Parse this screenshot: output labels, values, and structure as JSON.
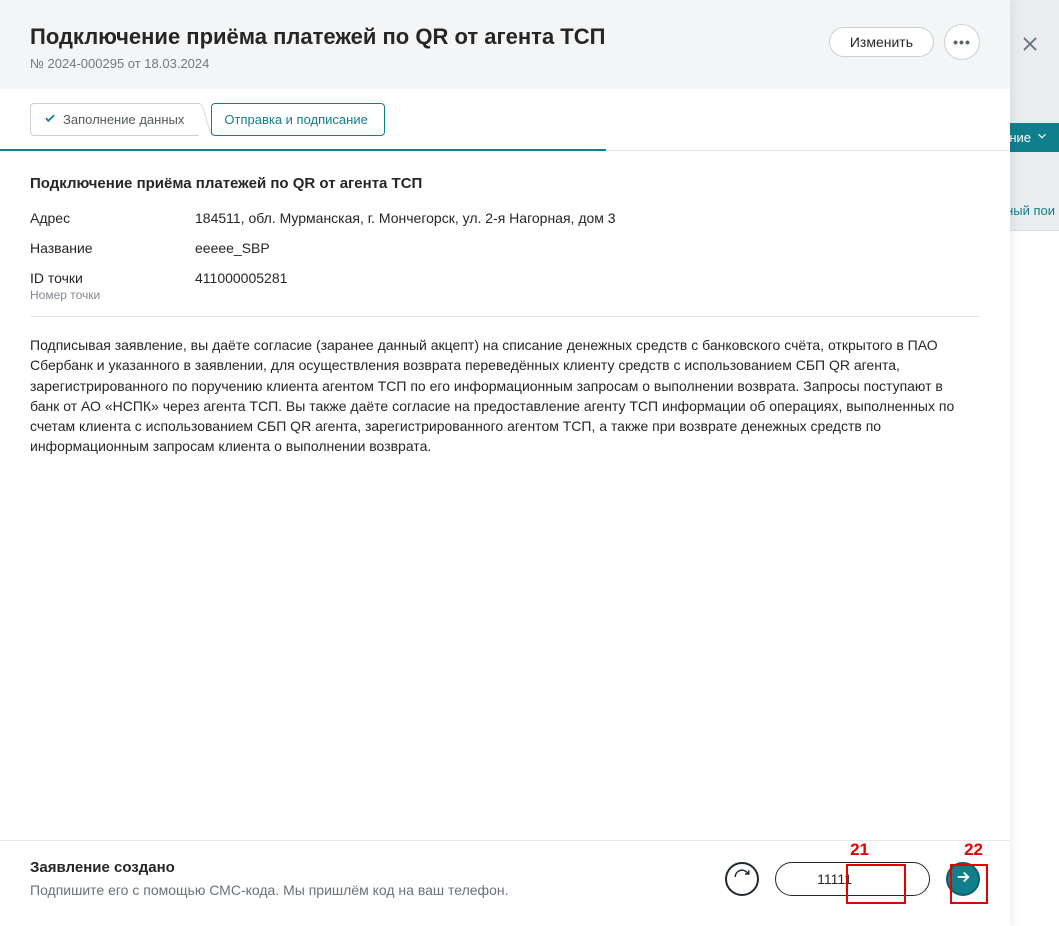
{
  "background": {
    "dropdown_text_fragment": "ние",
    "search_text_fragment": "ный пои"
  },
  "header": {
    "title": "Подключение приёма платежей по QR от агента ТСП",
    "subtitle": "№ 2024-000295 от 18.03.2024",
    "edit_label": "Изменить",
    "more_label": "•••"
  },
  "stepper": {
    "step1_label": "Заполнение данных",
    "step2_label": "Отправка и подписание"
  },
  "section": {
    "title": "Подключение приёма платежей по QR от агента ТСП",
    "rows": {
      "address_label": "Адрес",
      "address_value": "184511, обл. Мурманская, г. Мончегорск, ул. 2-я Нагорная, дом 3",
      "name_label": "Название",
      "name_value": "eeeee_SBP",
      "id_label": "ID точки",
      "id_sublabel": "Номер точки",
      "id_value": "411000005281"
    }
  },
  "consent_text": "Подписывая заявление, вы даёте согласие (заранее данный акцепт) на списание денежных средств с банковского счёта, открытого в ПАО Сбербанк и указанного в заявлении, для осуществления возврата переведённых клиенту средств с использованием СБП QR агента, зарегистрированного по поручению клиента агентом ТСП по его информационным запросам о выполнении возврата. Запросы поступают в банк от АО «НСПК» через агента ТСП. Вы также даёте согласие на предоставление агенту ТСП информации об операциях, выполненных по счетам клиента с использованием СБП QR агента, зарегистрированного агентом ТСП, а также при возврате денежных средств по информационным запросам клиента о выполнении возврата.",
  "footer": {
    "status_title": "Заявление создано",
    "status_sub": "Подпишите его с помощью СМС-кода. Мы пришлём код на ваш телефон.",
    "sms_value": "11111"
  },
  "annotations": {
    "label21": "21",
    "label22": "22"
  }
}
